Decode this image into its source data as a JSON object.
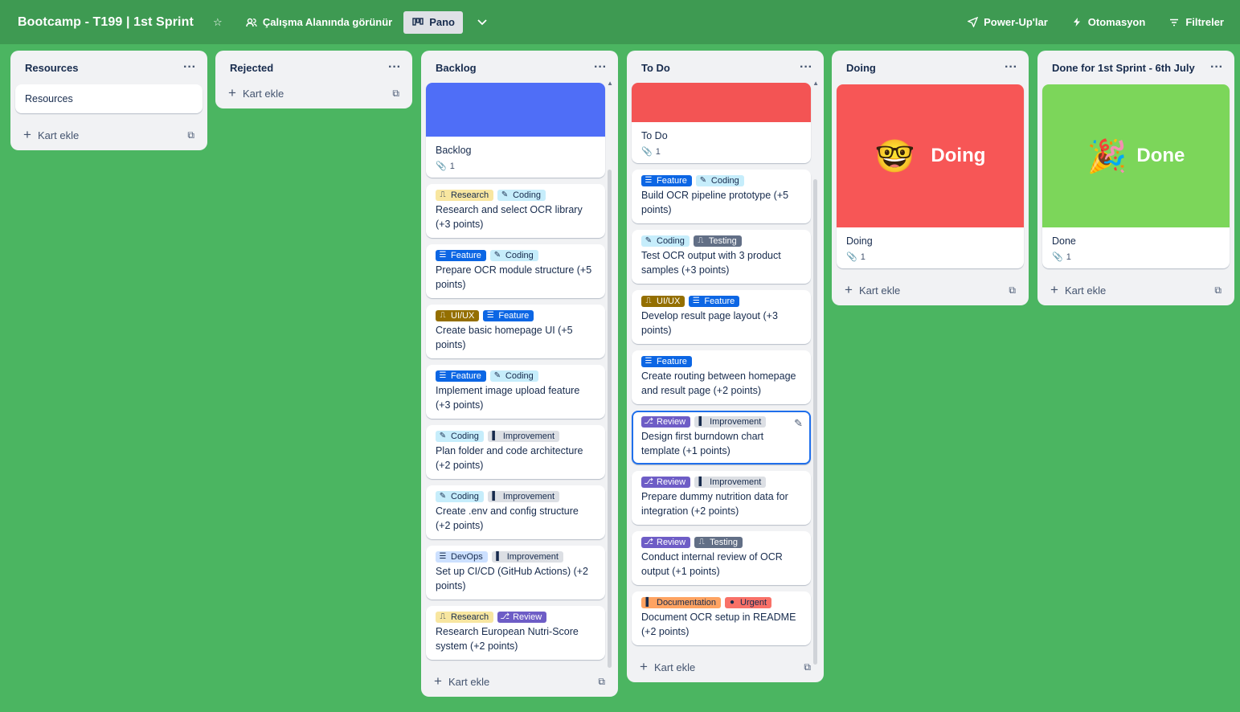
{
  "header": {
    "title": "Bootcamp - T199 | 1st Sprint",
    "visibility": "Çalışma Alanında görünür",
    "view": "Pano",
    "powerups": "Power-Up'lar",
    "automation": "Otomasyon",
    "filters": "Filtreler"
  },
  "add_card": "Kart ekle",
  "colors": {
    "green": "#4bb561",
    "header": "#3e9a52",
    "blue_cover": "#4f6ef7",
    "red_cover": "#f35454",
    "doing_cover": "#f75656",
    "done_cover": "#7cd65a"
  },
  "labels": {
    "research": {
      "text": "Research",
      "bg": "#f8e6a0",
      "icon": "research-icon"
    },
    "coding": {
      "text": "Coding",
      "bg": "#c6edfb",
      "icon": "pencil-icon"
    },
    "feature": {
      "text": "Feature",
      "bg": "#0c66e4",
      "icon": "flag-icon"
    },
    "uiux": {
      "text": "UI/UX",
      "bg": "#946f00",
      "icon": "design-icon"
    },
    "improvement": {
      "text": "Improvement",
      "bg": "#dcdfe4",
      "icon": "improve-icon"
    },
    "devops": {
      "text": "DevOps",
      "bg": "#cce0ff",
      "icon": "server-icon"
    },
    "review": {
      "text": "Review",
      "bg": "#6e5dc6",
      "icon": "review-icon"
    },
    "testing": {
      "text": "Testing",
      "bg": "#626f86",
      "icon": "test-icon"
    },
    "documentation": {
      "text": "Documentation",
      "bg": "#fea362",
      "icon": "doc-icon"
    },
    "urgent": {
      "text": "Urgent",
      "bg": "#f87168",
      "icon": "alert-icon"
    }
  },
  "lists": {
    "resources": {
      "title": "Resources",
      "cards": [
        "Resources"
      ]
    },
    "rejected": {
      "title": "Rejected"
    },
    "backlog": {
      "title": "Backlog",
      "cover_card": {
        "title": "Backlog",
        "attachments": "1"
      },
      "cards": [
        {
          "title": "Research and select OCR library (+3 points)"
        },
        {
          "title": "Prepare OCR module structure (+5 points)"
        },
        {
          "title": "Create basic homepage UI (+5 points)"
        },
        {
          "title": "Implement image upload feature (+3 points)"
        },
        {
          "title": "Plan folder and code architecture (+2 points)"
        },
        {
          "title": "Create .env and config structure (+2 points)"
        },
        {
          "title": "Set up CI/CD (GitHub Actions) (+2 points)"
        },
        {
          "title": "Research European Nutri-Score system (+2 points)"
        }
      ]
    },
    "todo": {
      "title": "To Do",
      "cover_card": {
        "title": "To Do",
        "attachments": "1"
      },
      "cards": [
        {
          "title": "Build OCR pipeline prototype (+5 points)"
        },
        {
          "title": "Test OCR output with 3 product samples (+3 points)"
        },
        {
          "title": "Develop result page layout (+3 points)"
        },
        {
          "title": "Create routing between homepage and result page (+2 points)"
        },
        {
          "title": "Design first burndown chart template (+1 points)"
        },
        {
          "title": "Prepare dummy nutrition data for integration (+2 points)"
        },
        {
          "title": "Conduct internal review of OCR output (+1 points)"
        },
        {
          "title": "Document OCR setup in README (+2 points)"
        }
      ]
    },
    "doing": {
      "title": "Doing",
      "cover_text": "Doing",
      "cover_emoji": "🤓",
      "card_title": "Doing",
      "attachments": "1"
    },
    "done": {
      "title": "Done for 1st Sprint - 6th July",
      "cover_text": "Done",
      "cover_emoji": "🎉",
      "card_title": "Done",
      "attachments": "1"
    }
  }
}
